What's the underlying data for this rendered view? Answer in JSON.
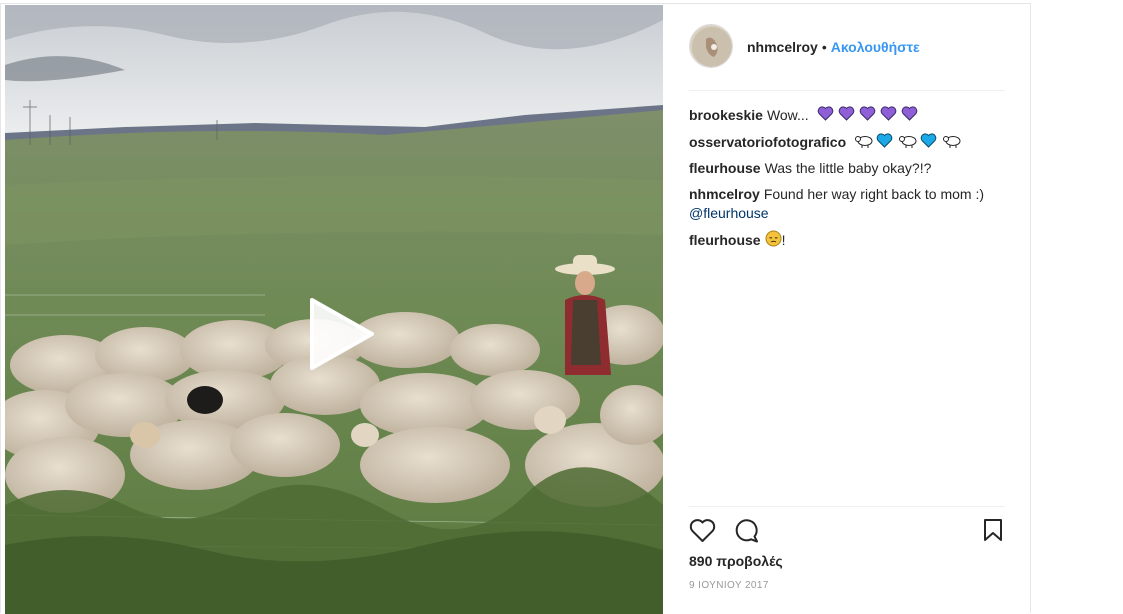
{
  "post": {
    "username": "nhmcelroy",
    "separator": "•",
    "follow_label": "Ακολουθήστε",
    "video": {
      "play_icon": "play-icon"
    },
    "comments": [
      {
        "user": "brookeskie",
        "text": "Wow...",
        "emojis": [
          "purple-heart",
          "purple-heart",
          "purple-heart",
          "purple-heart",
          "purple-heart"
        ]
      },
      {
        "user": "osservatoriofotografico",
        "text": "",
        "emojis": [
          "sheep",
          "blue-heart",
          "sheep",
          "blue-heart",
          "sheep"
        ]
      },
      {
        "user": "fleurhouse",
        "text": "Was the little baby okay?!?"
      },
      {
        "user": "nhmcelroy",
        "text": "Found her way right back to mom :)",
        "mention": "@fleurhouse"
      },
      {
        "user": "fleurhouse",
        "text": "!",
        "emojis": [
          "pensive-face"
        ]
      }
    ],
    "actions": {
      "like_icon": "heart-icon",
      "comment_icon": "comment-icon",
      "save_icon": "bookmark-icon"
    },
    "views": "890 προβολές",
    "date": "9 ΙΟΥΝΙΟΥ 2017"
  },
  "colors": {
    "link": "#3897f0",
    "mention": "#003569",
    "purple_heart": "#8e5fd6",
    "blue_heart": "#1aa8e6"
  }
}
